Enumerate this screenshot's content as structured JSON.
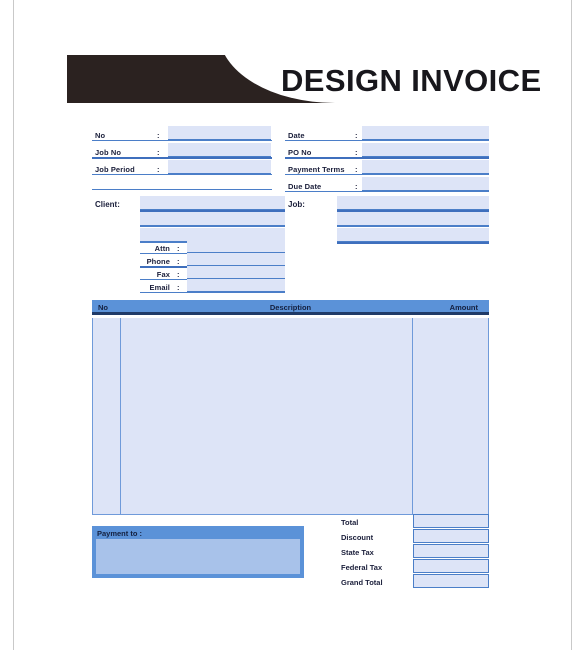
{
  "document": {
    "title": "DESIGN INVOICE",
    "type": "invoice-template"
  },
  "theme": {
    "masthead_dark": "#2b2220",
    "title_color": "#18171c",
    "header_blue": "#5b92d8",
    "field_fill": "#dde4f7",
    "field_rule": "#4b7ec8",
    "payment_inner": "#a8c2ea",
    "label_text": "#1b1f3b",
    "page_border": "#c9c9c9"
  },
  "meta_left": {
    "rows": [
      {
        "label": "No",
        "colon": ":",
        "value": ""
      },
      {
        "label": "Job No",
        "colon": ":",
        "value": ""
      },
      {
        "label": "Job Period",
        "colon": ":",
        "value": ""
      }
    ]
  },
  "meta_right": {
    "rows": [
      {
        "label": "Date",
        "colon": ":",
        "value": ""
      },
      {
        "label": "PO No",
        "colon": ":",
        "value": ""
      },
      {
        "label": "Payment Terms",
        "colon": ":",
        "value": ""
      },
      {
        "label": "Due Date",
        "colon": ":",
        "value": ""
      }
    ]
  },
  "client": {
    "section_label": "Client:",
    "address_lines": [
      "",
      "",
      ""
    ],
    "contact_rows": [
      {
        "label": "Attn",
        "colon": ":",
        "value": ""
      },
      {
        "label": "Phone",
        "colon": ":",
        "value": ""
      },
      {
        "label": "Fax",
        "colon": ":",
        "value": ""
      },
      {
        "label": "Email",
        "colon": ":",
        "value": ""
      }
    ]
  },
  "job": {
    "section_label": "Job:",
    "address_lines": [
      "",
      "",
      ""
    ]
  },
  "items_table": {
    "columns": [
      "No",
      "Description",
      "Amount"
    ],
    "rows": []
  },
  "payment": {
    "label": "Payment to :",
    "value": ""
  },
  "totals": {
    "rows": [
      {
        "label": "Total",
        "value": ""
      },
      {
        "label": "Discount",
        "value": ""
      },
      {
        "label": "State Tax",
        "value": ""
      },
      {
        "label": "Federal Tax",
        "value": ""
      },
      {
        "label": "Grand Total",
        "value": ""
      }
    ]
  }
}
